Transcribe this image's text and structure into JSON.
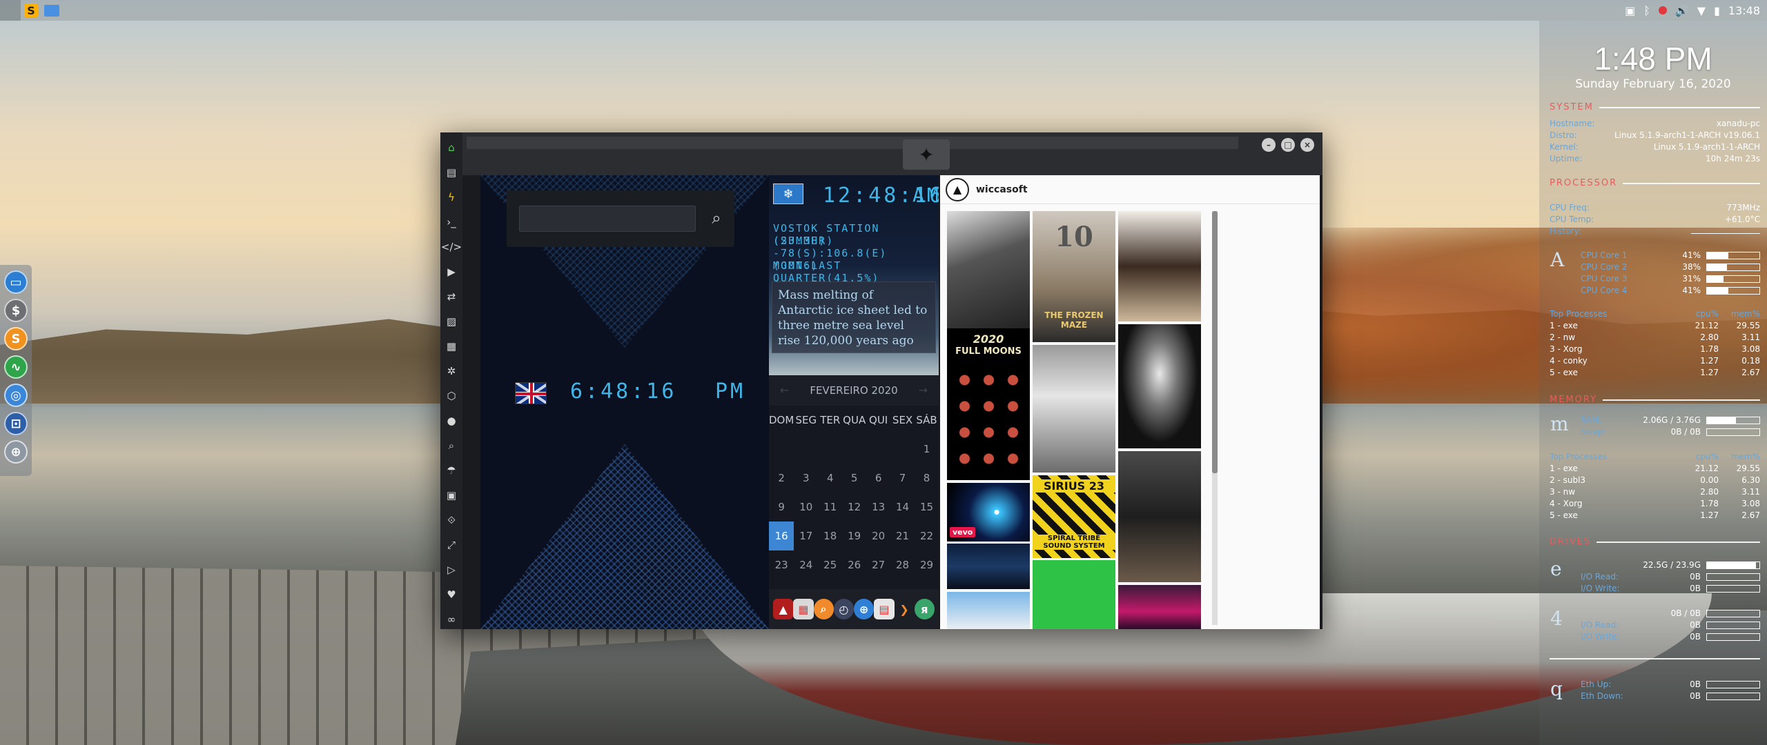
{
  "topbar": {
    "time": "13:48"
  },
  "conky": {
    "clock": "1:48 PM",
    "date": "Sunday February 16, 2020",
    "system": {
      "title": "SYSTEM",
      "rows": [
        {
          "k": "Hostname:",
          "v": "xanadu-pc"
        },
        {
          "k": "Distro:",
          "v": "Linux 5.1.9-arch1-1-ARCH v19.06.1"
        },
        {
          "k": "Kernel:",
          "v": "Linux 5.1.9-arch1-1-ARCH"
        },
        {
          "k": "Uptime:",
          "v": "10h 24m 23s"
        }
      ]
    },
    "processor": {
      "title": "PROCESSOR",
      "rows": [
        {
          "k": "CPU Freq:",
          "v": "773MHz"
        },
        {
          "k": "CPU Temp:",
          "v": "+61.0°C"
        },
        {
          "k": "History:",
          "v": ""
        }
      ],
      "glyph": "A",
      "cores": [
        {
          "k": "CPU Core 1",
          "v": "41%",
          "pct": 41
        },
        {
          "k": "CPU Core 2",
          "v": "38%",
          "pct": 38
        },
        {
          "k": "CPU Core 3",
          "v": "31%",
          "pct": 31
        },
        {
          "k": "CPU Core 4",
          "v": "41%",
          "pct": 41
        }
      ],
      "procs_header": [
        "Top Processes",
        "cpu%",
        "mem%"
      ],
      "procs": [
        [
          "1 - exe",
          "21.12",
          "29.55"
        ],
        [
          "2 - nw",
          "2.80",
          "3.11"
        ],
        [
          "3 - Xorg",
          "1.78",
          "3.08"
        ],
        [
          "4 - conky",
          "1.27",
          "0.18"
        ],
        [
          "5 - exe",
          "1.27",
          "2.67"
        ]
      ]
    },
    "memory": {
      "title": "MEMORY",
      "glyph": "m",
      "rows": [
        {
          "k": "RAM:",
          "v": "2.06G / 3.76G",
          "pct": 55
        },
        {
          "k": "Swap:",
          "v": "0B / 0B",
          "pct": 0
        }
      ],
      "procs_header": [
        "Top Processes",
        "cpu%",
        "mem%"
      ],
      "procs": [
        [
          "1 - exe",
          "21.12",
          "29.55"
        ],
        [
          "2 - subl3",
          "0.00",
          "6.30"
        ],
        [
          "3 - nw",
          "2.80",
          "3.11"
        ],
        [
          "4 - Xorg",
          "1.78",
          "3.08"
        ],
        [
          "5 - exe",
          "1.27",
          "2.67"
        ]
      ]
    },
    "drives": {
      "title": "DRIVES",
      "glyph1": "e",
      "glyph2": "4",
      "rows": [
        {
          "k": "",
          "v": "22.5G / 23.9G",
          "pct": 94
        },
        {
          "k": "I/O Read:",
          "v": "0B",
          "pct": 0
        },
        {
          "k": "I/O Write:",
          "v": "0B",
          "pct": 0
        },
        {
          "k": "",
          "v": "0B / 0B",
          "pct": 0
        },
        {
          "k": "I/O Read:",
          "v": "0B",
          "pct": 0
        },
        {
          "k": "I/O Write:",
          "v": "0B",
          "pct": 0
        }
      ]
    },
    "network": {
      "glyph": "q",
      "rows": [
        {
          "k": "Eth Up:",
          "v": "0B",
          "pct": 0
        },
        {
          "k": "Eth Down:",
          "v": "0B",
          "pct": 0
        }
      ]
    }
  },
  "window": {
    "uk_clock": {
      "time": "6:48:16",
      "ampm": "PM"
    },
    "search": {
      "placeholder": ""
    },
    "antarctica": {
      "time": "12:48:16",
      "ampm": "AM",
      "lines": [
        "VOSTOK STATION (SUMMER)",
        "(23.3H)",
        "-78(S):106.8(E) (GMT6)",
        "MOON:LAST QUARTER(41.5%)"
      ]
    },
    "news": "Mass melting of Antarctic ice sheet led to three metre sea level rise 120,000 years ago",
    "calendar": {
      "month": "FEVEREIRO 2020",
      "dows": [
        "DOM",
        "SEG",
        "TER",
        "QUA",
        "QUI",
        "SEX",
        "SÁB"
      ],
      "days": [
        "",
        "",
        "",
        "",
        "",
        "",
        "1",
        "2",
        "3",
        "4",
        "5",
        "6",
        "7",
        "8",
        "9",
        "10",
        "11",
        "12",
        "13",
        "14",
        "15",
        "16",
        "17",
        "18",
        "19",
        "20",
        "21",
        "22",
        "23",
        "24",
        "25",
        "26",
        "27",
        "28",
        "29"
      ],
      "today": "16"
    },
    "instagram": {
      "username": "wiccasoft",
      "posts": [
        {
          "title": "10",
          "subtitle": "THE FROZEN MAZE"
        },
        {
          "title": "2020",
          "subtitle": "FULL MOONS"
        },
        {
          "title": "SIRIUS 23",
          "subtitle": "SPIRAL TRIBE SOUND SYSTEM"
        },
        {
          "title": "vevo",
          "subtitle": ""
        }
      ]
    }
  }
}
